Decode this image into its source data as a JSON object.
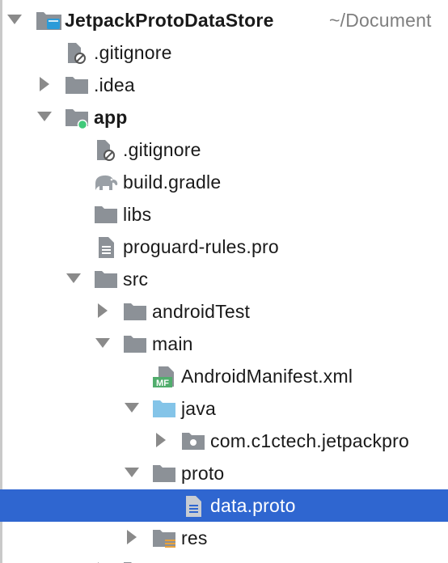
{
  "project": {
    "name": "JetpackProtoDataStore",
    "path": "~/Document"
  },
  "rows": [
    {
      "label": ".gitignore"
    },
    {
      "label": ".idea"
    },
    {
      "label": "app"
    },
    {
      "label": ".gitignore"
    },
    {
      "label": "build.gradle"
    },
    {
      "label": "libs"
    },
    {
      "label": "proguard-rules.pro"
    },
    {
      "label": "src"
    },
    {
      "label": "androidTest"
    },
    {
      "label": "main"
    },
    {
      "label": "AndroidManifest.xml"
    },
    {
      "label": "java"
    },
    {
      "label": "com.c1ctech.jetpackpro"
    },
    {
      "label": "proto"
    },
    {
      "label": "data.proto"
    },
    {
      "label": "res"
    }
  ],
  "colors": {
    "selection": "#2f66d0",
    "folder": "#8c9197",
    "source_folder": "#84c4e8",
    "module_dot": "#41c97a",
    "manifest_badge": "#51ad6d"
  }
}
